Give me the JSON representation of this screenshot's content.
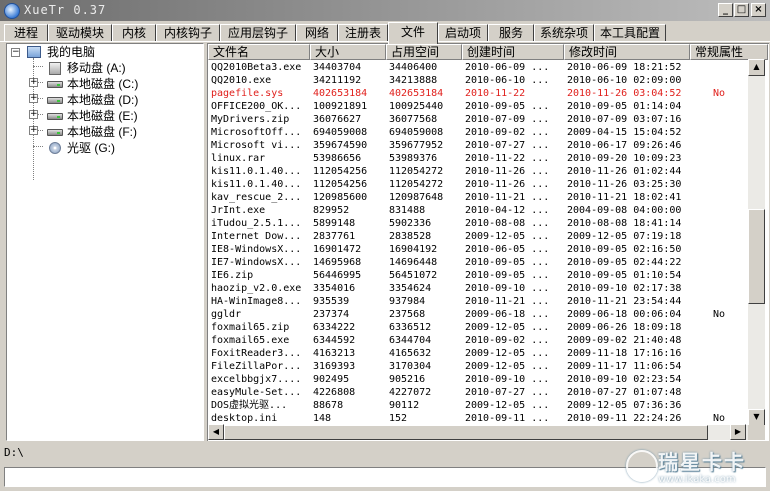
{
  "window": {
    "title": "XueTr 0.37",
    "minimize": "_",
    "maximize": "□",
    "close": "×"
  },
  "tabs": [
    {
      "label": "进程"
    },
    {
      "label": "驱动模块"
    },
    {
      "label": "内核"
    },
    {
      "label": "内核钩子"
    },
    {
      "label": "应用层钩子"
    },
    {
      "label": "网络"
    },
    {
      "label": "注册表"
    },
    {
      "label": "文件"
    },
    {
      "label": "启动项"
    },
    {
      "label": "服务"
    },
    {
      "label": "系统杂项"
    },
    {
      "label": "本工具配置"
    }
  ],
  "active_tab": "文件",
  "tree": {
    "root": "我的电脑",
    "items": [
      {
        "label": "移动盘 (A:)",
        "icon": "usb-drive-icon",
        "expandable": false
      },
      {
        "label": "本地磁盘 (C:)",
        "icon": "hard-drive-icon",
        "expandable": true
      },
      {
        "label": "本地磁盘 (D:)",
        "icon": "hard-drive-icon",
        "expandable": true
      },
      {
        "label": "本地磁盘 (E:)",
        "icon": "hard-drive-icon",
        "expandable": true
      },
      {
        "label": "本地磁盘 (F:)",
        "icon": "hard-drive-icon",
        "expandable": true
      },
      {
        "label": "光驱 (G:)",
        "icon": "cd-drive-icon",
        "expandable": false
      }
    ]
  },
  "columns": [
    "文件名",
    "大小",
    "占用空间",
    "创建时间",
    "修改时间",
    "常规属性"
  ],
  "rows": [
    [
      "QQ2010Beta3.exe",
      "34403704",
      "34406400",
      "2010-06-09 ...",
      "2010-06-09 18:21:52",
      ""
    ],
    [
      "QQ2010.exe",
      "34211192",
      "34213888",
      "2010-06-10 ...",
      "2010-06-10 02:09:00",
      ""
    ],
    [
      "pagefile.sys",
      "402653184",
      "402653184",
      "2010-11-22",
      "2010-11-26 03:04:52",
      "No"
    ],
    [
      "OFFICE200_OK...",
      "100921891",
      "100925440",
      "2010-09-05 ...",
      "2010-09-05 01:14:04",
      ""
    ],
    [
      "MyDrivers.zip",
      "36076627",
      "36077568",
      "2010-07-09 ...",
      "2010-07-09 03:07:16",
      ""
    ],
    [
      "MicrosoftOff...",
      "694059008",
      "694059008",
      "2010-09-02 ...",
      "2009-04-15 15:04:52",
      ""
    ],
    [
      "Microsoft vi...",
      "359674590",
      "359677952",
      "2010-07-27 ...",
      "2010-06-17 09:26:46",
      ""
    ],
    [
      "linux.rar",
      "53986656",
      "53989376",
      "2010-11-22 ...",
      "2010-09-20 10:09:23",
      ""
    ],
    [
      "kis11.0.1.40...",
      "112054256",
      "112054272",
      "2010-11-26 ...",
      "2010-11-26 01:02:44",
      ""
    ],
    [
      "kis11.0.1.40...",
      "112054256",
      "112054272",
      "2010-11-26 ...",
      "2010-11-26 03:25:30",
      ""
    ],
    [
      "kav_rescue_2...",
      "120985600",
      "120987648",
      "2010-11-21 ...",
      "2010-11-21 18:02:41",
      ""
    ],
    [
      "JrInt.exe",
      "829952",
      "831488",
      "2010-04-12 ...",
      "2004-09-08 04:00:00",
      ""
    ],
    [
      "iTudou_2.5.1...",
      "5899148",
      "5902336",
      "2010-08-08 ...",
      "2010-08-08 18:41:14",
      ""
    ],
    [
      "Internet Dow...",
      "2837761",
      "2838528",
      "2009-12-05 ...",
      "2009-12-05 07:19:18",
      ""
    ],
    [
      "IE8-WindowsX...",
      "16901472",
      "16904192",
      "2010-06-05 ...",
      "2010-09-05 02:16:50",
      ""
    ],
    [
      "IE7-WindowsX...",
      "14695968",
      "14696448",
      "2010-09-05 ...",
      "2010-09-05 02:44:22",
      ""
    ],
    [
      "IE6.zip",
      "56446995",
      "56451072",
      "2010-09-05 ...",
      "2010-09-05 01:10:54",
      ""
    ],
    [
      "haozip_v2.0.exe",
      "3354016",
      "3354624",
      "2010-09-10 ...",
      "2010-09-10 02:17:38",
      ""
    ],
    [
      "HA-WinImage8...",
      "935539",
      "937984",
      "2010-11-21 ...",
      "2010-11-21 23:54:44",
      ""
    ],
    [
      "ggldr",
      "237374",
      "237568",
      "2009-06-18 ...",
      "2009-06-18 00:06:04",
      "No"
    ],
    [
      "foxmail65.zip",
      "6334222",
      "6336512",
      "2009-12-05 ...",
      "2009-06-26 18:09:18",
      ""
    ],
    [
      "foxmail65.exe",
      "6344592",
      "6344704",
      "2010-09-02 ...",
      "2009-09-02 21:40:48",
      ""
    ],
    [
      "FoxitReader3...",
      "4163213",
      "4165632",
      "2009-12-05 ...",
      "2009-11-18 17:16:16",
      ""
    ],
    [
      "FileZillaPor...",
      "3169393",
      "3170304",
      "2009-12-05 ...",
      "2009-11-17 11:06:54",
      ""
    ],
    [
      "excelbbgjx7....",
      "902495",
      "905216",
      "2010-09-10 ...",
      "2010-09-10 02:23:54",
      ""
    ],
    [
      "easyMule-Set...",
      "4226808",
      "4227072",
      "2010-07-27 ...",
      "2010-07-27 01:07:48",
      ""
    ],
    [
      "DOS虚拟光驱...",
      "88678",
      "90112",
      "2009-12-05 ...",
      "2009-12-05 07:36:36",
      ""
    ],
    [
      "desktop.ini",
      "148",
      "152",
      "2010-09-11 ...",
      "2010-09-11 22:24:26",
      "No"
    ]
  ],
  "highlight_color": "#e0201c",
  "path": "D:\\",
  "watermark": {
    "main": "瑞星卡卡",
    "sub": "www.ikaka.com"
  }
}
